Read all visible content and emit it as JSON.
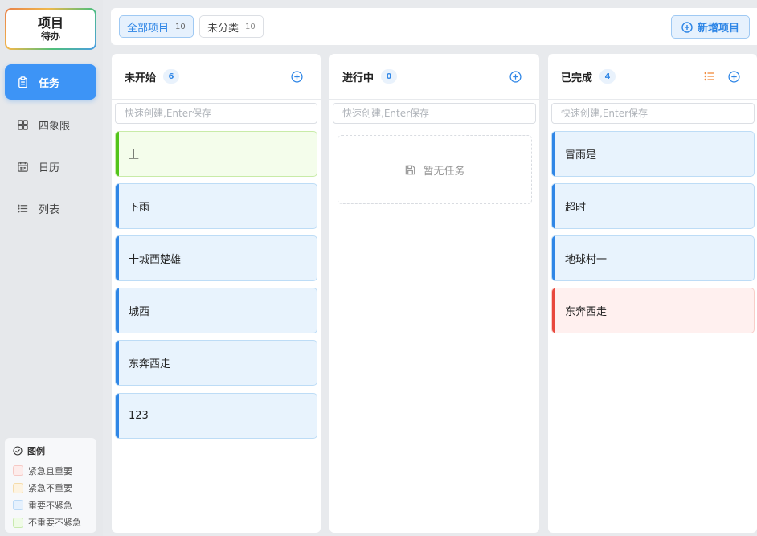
{
  "logo": {
    "line1": "项目",
    "line2": "待办"
  },
  "nav": [
    {
      "label": "任务",
      "icon": "clipboard-icon",
      "active": true
    },
    {
      "label": "四象限",
      "icon": "grid-icon",
      "active": false
    },
    {
      "label": "日历",
      "icon": "calendar-icon",
      "active": false
    },
    {
      "label": "列表",
      "icon": "list-icon",
      "active": false
    }
  ],
  "legend": {
    "title": "图例",
    "items": [
      {
        "label": "紧急且重要",
        "color": "#fdeceb"
      },
      {
        "label": "紧急不重要",
        "color": "#fdf3e1"
      },
      {
        "label": "重要不紧急",
        "color": "#e6f1fd"
      },
      {
        "label": "不重要不紧急",
        "color": "#effbe6"
      }
    ]
  },
  "topbar": {
    "filters": [
      {
        "label": "全部项目",
        "count": "10",
        "active": true
      },
      {
        "label": "未分类",
        "count": "10",
        "active": false
      }
    ],
    "add_project_label": "新增项目"
  },
  "quick_placeholder": "快速创建,Enter保存",
  "columns": [
    {
      "title": "未开始",
      "count": "6",
      "cards": [
        {
          "text": "上",
          "tone": "green"
        },
        {
          "text": "下雨",
          "tone": "blue"
        },
        {
          "text": "十城西楚雄",
          "tone": "blue"
        },
        {
          "text": "城西",
          "tone": "blue"
        },
        {
          "text": "东奔西走",
          "tone": "blue"
        },
        {
          "text": "123",
          "tone": "blue"
        }
      ]
    },
    {
      "title": "进行中",
      "count": "0",
      "empty_label": "暂无任务",
      "cards": []
    },
    {
      "title": "已完成",
      "count": "4",
      "cards": [
        {
          "text": "冒雨是",
          "tone": "blue"
        },
        {
          "text": "超时",
          "tone": "blue"
        },
        {
          "text": "地球村一",
          "tone": "blue"
        },
        {
          "text": "东奔西走",
          "tone": "red"
        }
      ]
    }
  ],
  "colors": {
    "accent": "#3d94f6",
    "list_icon": "#f08a3c"
  }
}
